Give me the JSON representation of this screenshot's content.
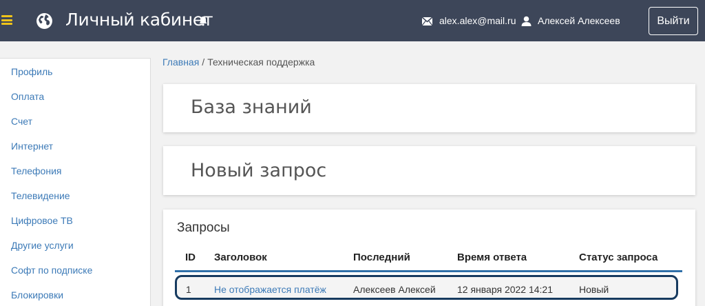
{
  "header": {
    "app_title": "Личный кабинет",
    "email": "alex.alex@mail.ru",
    "username": "Алексей Алексеев",
    "logout_label": "Выйти"
  },
  "sidebar": {
    "items": [
      {
        "label": "Профиль"
      },
      {
        "label": "Оплата"
      },
      {
        "label": "Счет"
      },
      {
        "label": "Интернет"
      },
      {
        "label": "Телефония"
      },
      {
        "label": "Телевидение"
      },
      {
        "label": "Цифровое ТВ"
      },
      {
        "label": "Другие услуги"
      },
      {
        "label": "Софт по подписке"
      },
      {
        "label": "Блокировки"
      }
    ]
  },
  "breadcrumb": {
    "home": "Главная",
    "separator": "/",
    "current": "Техническая поддержка"
  },
  "main": {
    "knowledge_base_title": "База знаний",
    "new_request_title": "Новый запрос",
    "requests": {
      "title": "Запросы",
      "columns": [
        "ID",
        "Заголовок",
        "Последний",
        "Время ответа",
        "Статус запроса"
      ],
      "rows": [
        {
          "id": "1",
          "subject": "Не отображается платёж",
          "last": "Алексеев Алексей",
          "time": "12 января 2022 14:21",
          "status": "Новый"
        }
      ]
    }
  },
  "colors": {
    "header_bg": "#3d4659",
    "accent_link": "#3c7ab7",
    "burger": "#f0c419",
    "row_highlight": "#163a5f"
  },
  "icons": [
    "menu-icon",
    "globe-icon",
    "bell-icon",
    "mail-icon",
    "user-icon"
  ]
}
